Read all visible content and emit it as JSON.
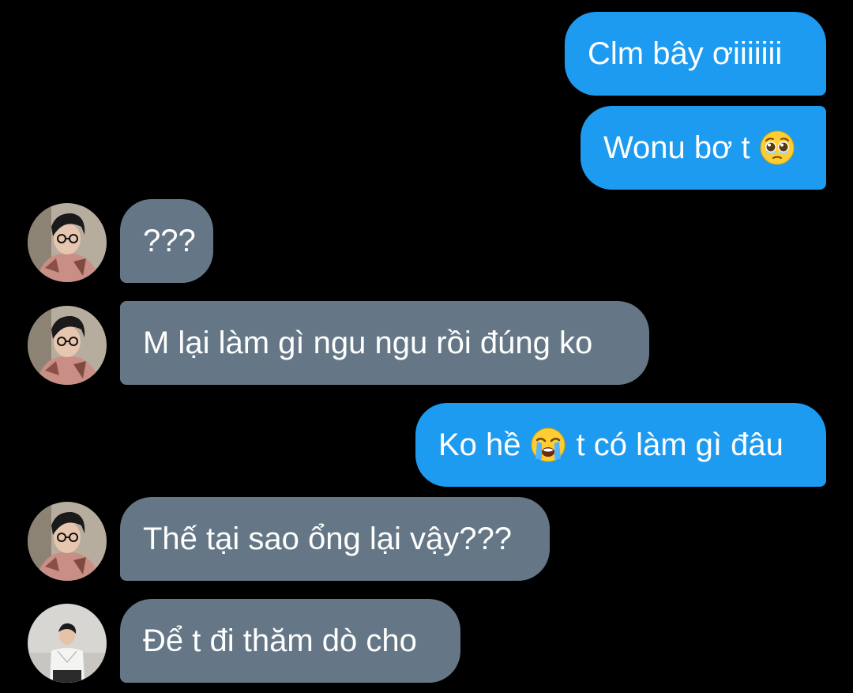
{
  "conversation": {
    "messages": [
      {
        "sender": "me",
        "text": "Clm bây ơiiiiiii"
      },
      {
        "sender": "me",
        "text_before": "Wonu bơ t",
        "emoji": "pleading-face-emoji"
      },
      {
        "sender": "friend-1",
        "text": "???"
      },
      {
        "sender": "friend-1",
        "text": "M lại làm gì ngu ngu rồi đúng ko"
      },
      {
        "sender": "me",
        "text_before": "Ko hề",
        "emoji": "loudly-crying-face-emoji",
        "text_after": "t có làm gì đâu"
      },
      {
        "sender": "friend-1",
        "text": "Thế tại sao ổng lại vậy???"
      },
      {
        "sender": "friend-2",
        "text": "Để t đi thăm dò cho"
      }
    ]
  },
  "colors": {
    "background": "#000000",
    "outgoing_bubble": "#1d9bf0",
    "incoming_bubble": "#657786",
    "text": "#ffffff"
  }
}
